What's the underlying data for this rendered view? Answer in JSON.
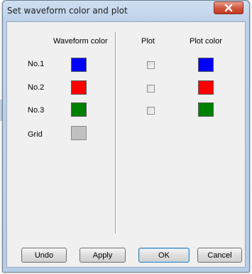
{
  "window": {
    "title": "Set waveform color and plot"
  },
  "headers": {
    "waveform_color": "Waveform color",
    "plot": "Plot",
    "plot_color": "Plot color"
  },
  "rows": [
    {
      "label": "No.1",
      "waveform_color": "#0000ff",
      "plot_checked": false,
      "plot_color": "#0000ff"
    },
    {
      "label": "No.2",
      "waveform_color": "#ff0000",
      "plot_checked": false,
      "plot_color": "#ff0000"
    },
    {
      "label": "No.3",
      "waveform_color": "#008000",
      "plot_checked": false,
      "plot_color": "#008000"
    },
    {
      "label": "Grid",
      "waveform_color": "#c0c0c0"
    }
  ],
  "buttons": {
    "undo": "Undo",
    "apply": "Apply",
    "ok": "OK",
    "cancel": "Cancel"
  }
}
